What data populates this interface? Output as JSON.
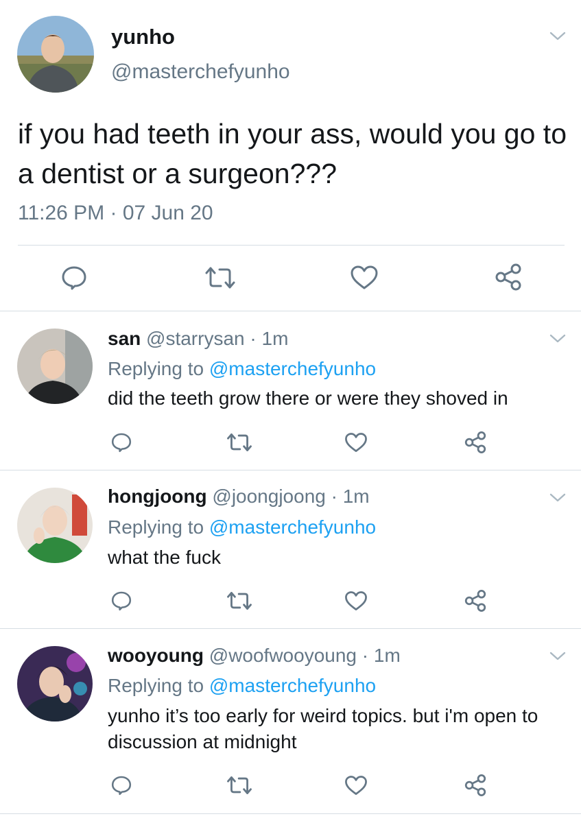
{
  "colors": {
    "accent": "#1da1f2",
    "muted": "#657786",
    "text": "#14171a",
    "divider": "#d6dde3"
  },
  "main_tweet": {
    "display_name": "yunho",
    "handle": "@masterchefyunho",
    "text": "if you had teeth in your ass, would you go to a dentist or a surgeon???",
    "timestamp": "11:26 PM · 07 Jun 20",
    "icons": [
      "reply-icon",
      "retweet-icon",
      "like-icon",
      "share-icon"
    ]
  },
  "replies": [
    {
      "display_name": "san",
      "handle": "@starrysan",
      "time": "· 1m",
      "replying_prefix": "Replying to ",
      "replying_to": "@masterchefyunho",
      "text": "did the teeth grow there or were they shoved in"
    },
    {
      "display_name": "hongjoong",
      "handle": "@joongjoong",
      "time": "· 1m",
      "replying_prefix": "Replying to ",
      "replying_to": "@masterchefyunho",
      "text": "what the fuck"
    },
    {
      "display_name": "wooyoung",
      "handle": "@woofwooyoung",
      "time": "· 1m",
      "replying_prefix": "Replying to ",
      "replying_to": "@masterchefyunho",
      "text": "yunho it’s too early for weird topics. but i'm open to discussion at midnight"
    }
  ]
}
